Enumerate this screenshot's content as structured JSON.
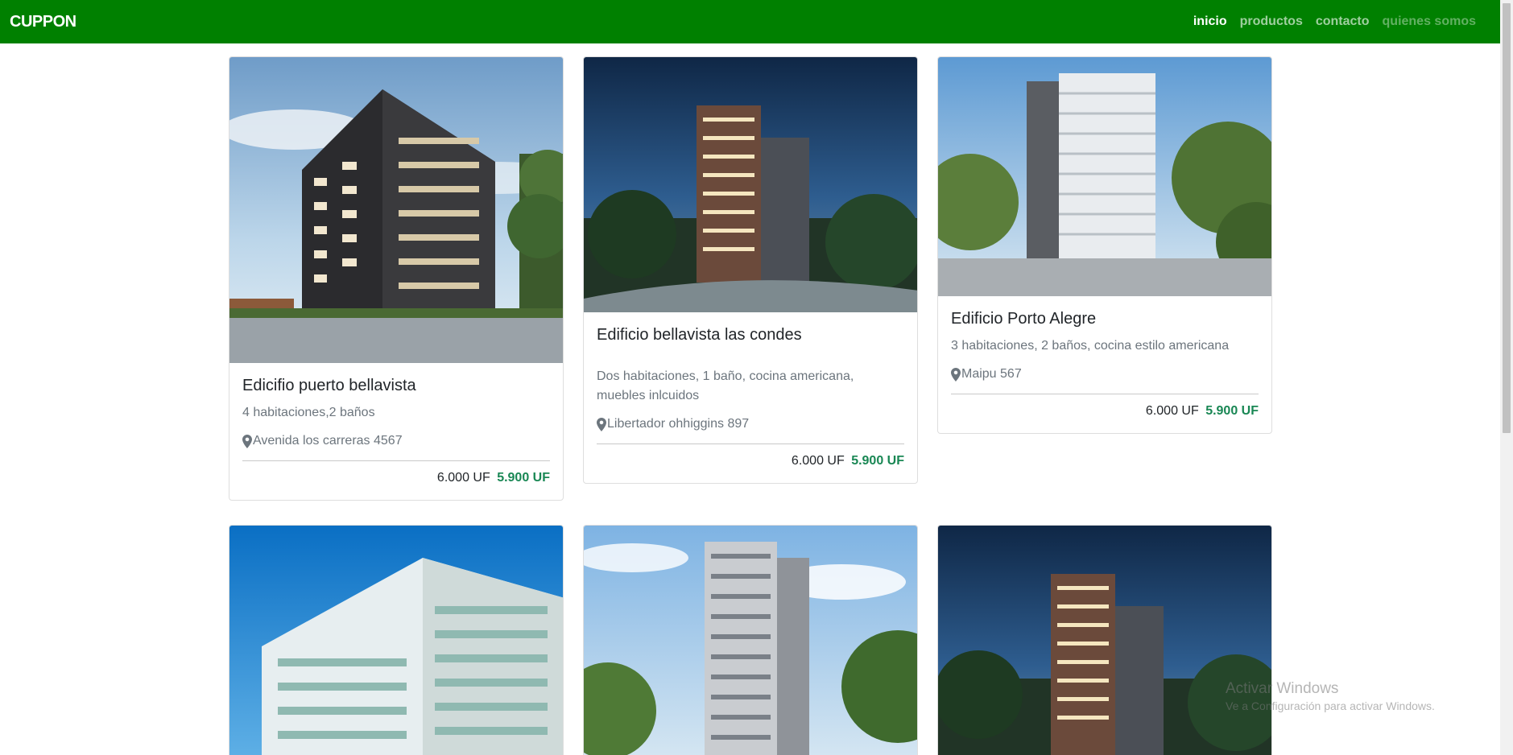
{
  "navbar": {
    "brand": "CUPPON",
    "links": [
      "inicio",
      "productos",
      "contacto",
      "quienes somos"
    ]
  },
  "cards": [
    {
      "title": "Edicifio puerto bellavista",
      "description": "4 habitaciones,2 baños",
      "address": "Avenida los carreras 4567",
      "price_old": "6.000 UF",
      "price_new": "5.900 UF"
    },
    {
      "title": "Edificio bellavista las condes",
      "description": "Dos habitaciones, 1 baño, cocina americana, muebles inlcuidos",
      "address": "Libertador ohhiggins 897",
      "price_old": "6.000 UF",
      "price_new": "5.900 UF"
    },
    {
      "title": "Edificio Porto Alegre",
      "description": "3 habitaciones, 2 baños, cocina estilo americana",
      "address": "Maipu 567",
      "price_old": "6.000 UF",
      "price_new": "5.900 UF"
    }
  ],
  "watermark": {
    "title": "Activar Windows",
    "subtitle": "Ve a Configuración para activar Windows."
  },
  "colors": {
    "navbar": "#008000",
    "offer_price": "#198754",
    "muted_text": "#6c757d"
  },
  "icons": [
    "map-marker-icon"
  ]
}
